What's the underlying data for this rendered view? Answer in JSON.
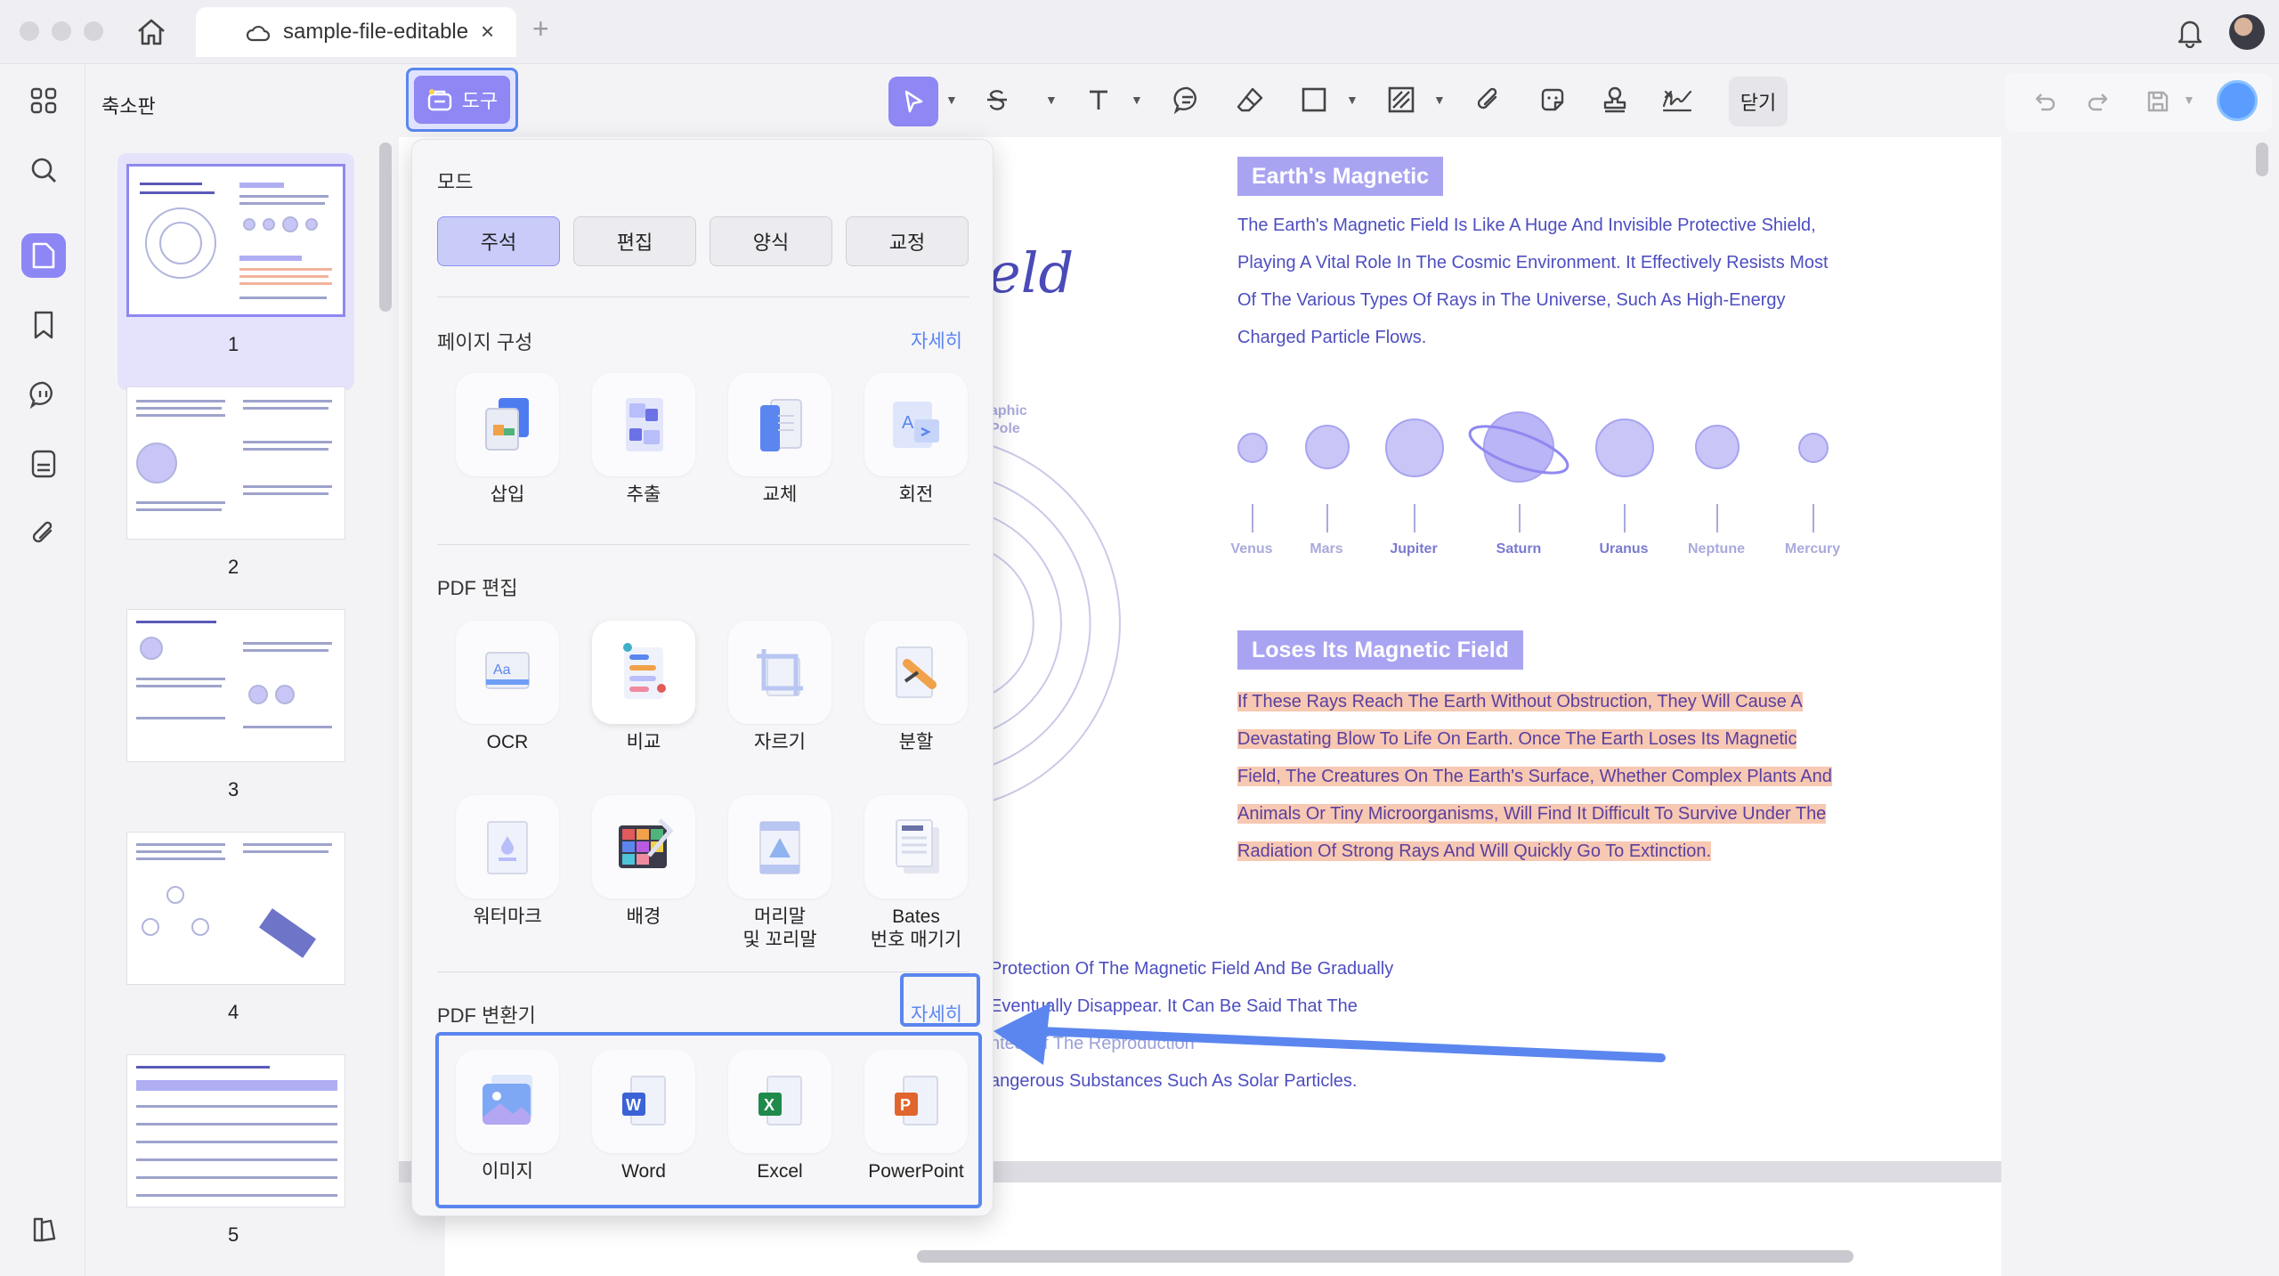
{
  "titlebar": {
    "tab_title": "sample-file-editable",
    "tab_close": "×",
    "tab_add": "+"
  },
  "thumbnails": {
    "title": "축소판",
    "pages": [
      "1",
      "2",
      "3",
      "4",
      "5"
    ]
  },
  "toolbar": {
    "tools_label": "도구",
    "close_label": "닫기"
  },
  "popup": {
    "mode_label": "모드",
    "modes": [
      "주석",
      "편집",
      "양식",
      "교정"
    ],
    "page_org": {
      "title": "페이지 구성",
      "more": "자세히",
      "items": [
        "삽입",
        "추출",
        "교체",
        "회전"
      ]
    },
    "pdf_edit": {
      "title": "PDF 편집",
      "items": [
        "OCR",
        "비교",
        "자르기",
        "분할",
        "워터마크",
        "배경",
        "머리말\n및 꼬리말",
        "Bates\n번호 매기기"
      ]
    },
    "converter": {
      "title": "PDF 변환기",
      "more": "자세히",
      "items": [
        "이미지",
        "Word",
        "Excel",
        "PowerPoint"
      ]
    }
  },
  "document": {
    "title_fragment": "eld",
    "mag_pole_label": "aphic\nPole",
    "section1": {
      "heading": "Earth's Magnetic",
      "lines": [
        "The Earth's Magnetic Field Is Like A Huge And Invisible Protective Shield,",
        "Playing A Vital Role In The Cosmic Environment. It Effectively Resists Most",
        "Of The Various Types Of Rays in The Universe, Such As High-Energy",
        "Charged Particle Flows."
      ]
    },
    "planets": [
      "Venus",
      "Mars",
      "Jupiter",
      "Saturn",
      "Uranus",
      "Neptune",
      "Mercury"
    ],
    "section2": {
      "heading": "Loses Its Magnetic Field",
      "lines": [
        "If These Rays Reach The Earth Without Obstruction, They Will Cause A",
        "Devastating Blow To Life On Earth. Once The Earth Loses Its Magnetic",
        "Field, The Creatures On The Earth's Surface, Whether Complex Plants And",
        "Animals Or Tiny Microorganisms, Will Find It Difficult To Survive Under The",
        "Radiation Of Strong Rays And Will Quickly Go To Extinction."
      ]
    },
    "lower_lines": [
      "Protection Of The Magnetic Field And Be Gradually",
      "Eventually Disappear. It Can Be Said That The",
      "ntea Of The Reproduction",
      "angerous Substances Such As Solar Particles."
    ]
  },
  "colors": {
    "accent": "#8e87f4",
    "highlight_box": "#5b86ef",
    "doc_text": "#4d4ec0",
    "text_highlight": "#f7c8b2"
  }
}
